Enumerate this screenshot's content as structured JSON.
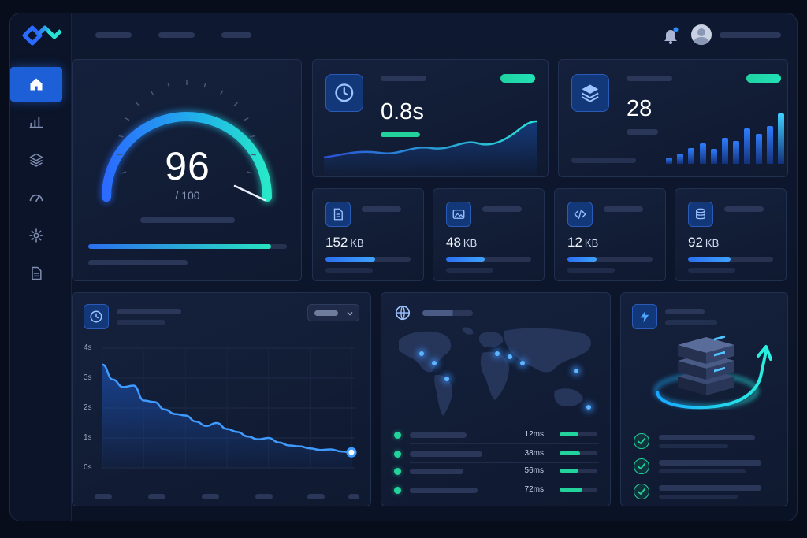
{
  "theme": {
    "accent": "#1d5fd6",
    "success": "#22d39c",
    "cyan": "#27e3d5",
    "background": "#070d1b"
  },
  "sidebar": {
    "items": [
      {
        "icon": "home-icon",
        "active": true
      },
      {
        "icon": "bar-chart-icon",
        "active": false
      },
      {
        "icon": "layers-icon",
        "active": false
      },
      {
        "icon": "speedometer-icon",
        "active": false
      },
      {
        "icon": "gear-icon",
        "active": false
      },
      {
        "icon": "document-icon",
        "active": false
      }
    ]
  },
  "header": {
    "icons": [
      "bell-icon",
      "avatar"
    ]
  },
  "score": {
    "value": "96",
    "max": "/ 100",
    "progress": 0.92
  },
  "load_time": {
    "value": "0.8s",
    "icon": "clock-icon"
  },
  "requests": {
    "value": "28",
    "icon": "layers-icon",
    "bars": [
      0.12,
      0.2,
      0.32,
      0.4,
      0.3,
      0.52,
      0.45,
      0.7,
      0.6,
      0.75,
      1.0
    ]
  },
  "assets": [
    {
      "icon": "file-icon",
      "value": "152",
      "unit": "KB",
      "fill": 0.58
    },
    {
      "icon": "image-icon",
      "value": "48",
      "unit": "KB",
      "fill": 0.45
    },
    {
      "icon": "code-icon",
      "value": "12",
      "unit": "KB",
      "fill": 0.34
    },
    {
      "icon": "database-icon",
      "value": "92",
      "unit": "KB",
      "fill": 0.5
    }
  ],
  "timeline": {
    "icon": "clock-icon",
    "y_ticks": [
      "4s",
      "3s",
      "2s",
      "1s",
      "0s"
    ],
    "chart_data": {
      "type": "area",
      "ylim": [
        0,
        4
      ],
      "values": [
        3.45,
        2.95,
        2.7,
        2.75,
        2.25,
        2.2,
        1.95,
        1.8,
        1.75,
        1.55,
        1.4,
        1.5,
        1.3,
        1.2,
        1.05,
        0.95,
        1.0,
        0.85,
        0.75,
        0.72,
        0.65,
        0.6,
        0.62,
        0.55,
        0.52
      ]
    }
  },
  "regions": {
    "icon": "globe-icon",
    "rows": [
      {
        "latency": "12ms",
        "fill": 0.5
      },
      {
        "latency": "38ms",
        "fill": 0.55
      },
      {
        "latency": "56ms",
        "fill": 0.5
      },
      {
        "latency": "72ms",
        "fill": 0.6
      }
    ]
  },
  "server": {
    "icon": "bolt-icon",
    "checks": 3
  }
}
